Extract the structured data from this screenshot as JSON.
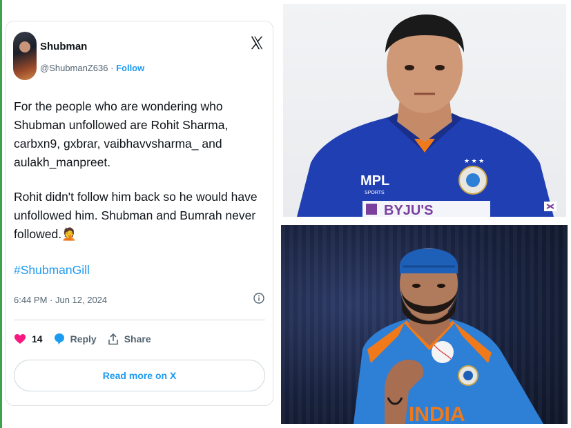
{
  "tweet": {
    "display_name": "Shubman",
    "handle": "@ShubmanZ636",
    "separator": "·",
    "follow_label": "Follow",
    "paragraph1": "For the people who are wondering who Shubman unfollowed are Rohit Sharma, carbxn9, gxbrar, vaibhavvsharma_ and aulakh_manpreet.",
    "paragraph2": "Rohit didn't follow him back so he would have unfollowed him. Shubman and Bumrah never followed.",
    "emoji": "🤦",
    "hashtag": "#ShubmanGill",
    "timestamp": "6:44 PM · Jun 12, 2024",
    "like_count": "14",
    "reply_label": "Reply",
    "share_label": "Share",
    "read_more_label": "Read more on X"
  },
  "photo_top": {
    "jersey_text": "MPL",
    "jersey_subtext": "SPORTS",
    "sponsor_text": "BYJU'S"
  },
  "photo_bottom": {
    "jersey_text": "INDIA"
  },
  "colors": {
    "accent": "#1d9bf0",
    "like": "#f91880",
    "text": "#0f1419",
    "muted": "#536471",
    "jersey_dark": "#1f3fb3",
    "jersey_light": "#2e7fd6"
  },
  "icons": [
    "x-logo-icon",
    "info-icon",
    "heart-icon",
    "reply-bubble-icon",
    "share-icon"
  ]
}
